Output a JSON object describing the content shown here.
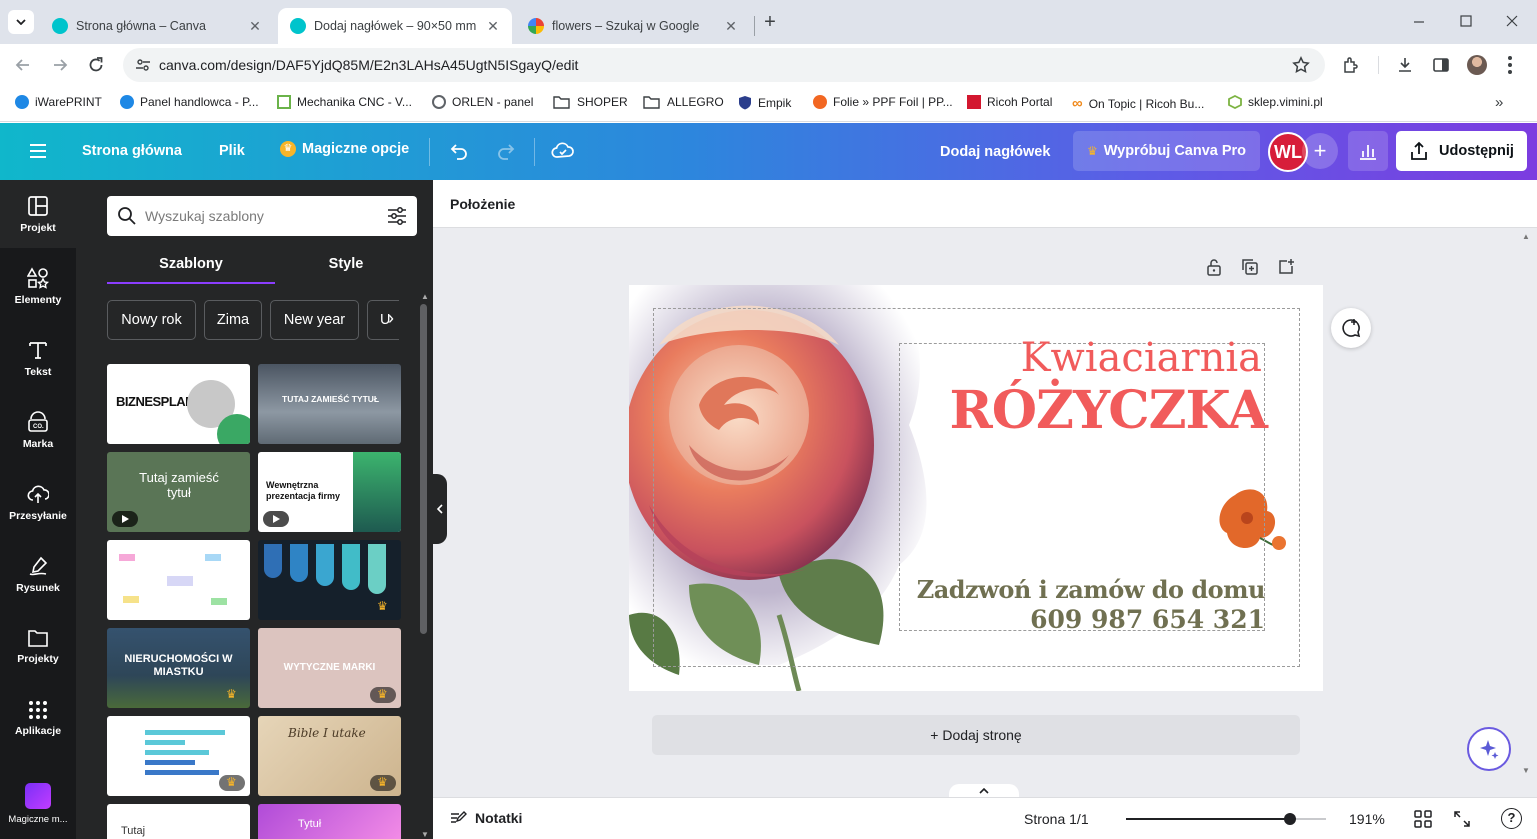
{
  "browser": {
    "tabs": [
      {
        "title": "Strona główna – Canva",
        "active": false
      },
      {
        "title": "Dodaj nagłówek – 90×50 mm",
        "active": true
      },
      {
        "title": "flowers – Szukaj w Google",
        "active": false
      }
    ],
    "url": "canva.com/design/DAF5YjdQ85M/E2n3LAHsA45UgtN5ISgayQ/edit",
    "bookmarks": [
      "iWarePRINT",
      "Panel handlowca - P...",
      "Mechanika CNC - V...",
      "ORLEN - panel",
      "SHOPER",
      "ALLEGRO",
      "Empik",
      "Folie » PPF Foil | PP...",
      "Ricoh Portal",
      "On Topic | Ricoh Bu...",
      "sklep.vimini.pl"
    ]
  },
  "canva": {
    "menu": {
      "home": "Strona główna",
      "file": "Plik",
      "magic": "Magiczne opcje"
    },
    "doc_title": "Dodaj nagłówek",
    "try_pro": "Wypróbuj Canva Pro",
    "avatar": "WL",
    "share": "Udostępnij",
    "rail": [
      "Projekt",
      "Elementy",
      "Tekst",
      "Marka",
      "Przesyłanie",
      "Rysunek",
      "Projekty",
      "Aplikacje",
      "Magiczne m..."
    ],
    "panel": {
      "search_placeholder": "Wyszukaj szablony",
      "tabs": [
        "Szablony",
        "Style"
      ],
      "chips": [
        "Nowy rok",
        "Zima",
        "New year",
        "U"
      ],
      "thumb_text": {
        "t1": "BIZNESPLAN",
        "t2": "TUTAJ ZAMIEŚĆ TYTUŁ",
        "t3": "Tutaj zamieść tytuł",
        "t4": "Wewnętrzna prezentacja firmy",
        "t7": "NIERUCHOMOŚCI W MIASTKU",
        "t8": "WYTYCZNE MARKI",
        "t10": "Bible I utake",
        "t11": "Tutaj",
        "t12": "Tytuł"
      }
    },
    "context": {
      "position": "Położenie"
    },
    "card": {
      "line1": "Kwiaciarnia",
      "line2": "RÓŻYCZKA",
      "line3": "Zadzwoń i zamów do domu",
      "line4": "609 987 654 321"
    },
    "add_page": "+ Dodaj stronę",
    "bottom": {
      "notes": "Notatki",
      "page": "Strona 1/1",
      "zoom": "191%",
      "zoom_fraction": 0.82
    }
  },
  "colors": {
    "accent_red": "#f15b5b",
    "olive_text": "#707051",
    "pro_gold": "#f7b529"
  }
}
